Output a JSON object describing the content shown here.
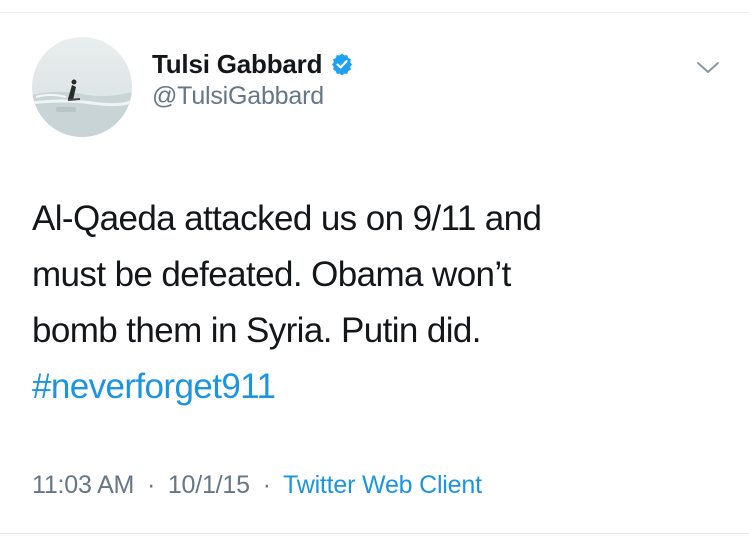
{
  "author": {
    "display_name": "Tulsi Gabbard",
    "handle": "@TulsiGabbard",
    "verified_icon": "verified-badge-icon",
    "avatar_icon": "avatar-photo"
  },
  "menu": {
    "icon": "chevron-down-icon"
  },
  "tweet": {
    "lines": [
      "Al-Qaeda attacked us on 9/11 and",
      "must be defeated. Obama won’t",
      "bomb them in Syria. Putin did."
    ],
    "hashtag": "#neverforget911"
  },
  "meta": {
    "time": "11:03 AM",
    "separator": "·",
    "date": "10/1/15",
    "source": "Twitter Web Client"
  },
  "colors": {
    "text": "#14171a",
    "secondary": "#657786",
    "link": "#1b95e0",
    "verified": "#1da1f2",
    "divider": "#e6ecf0"
  }
}
